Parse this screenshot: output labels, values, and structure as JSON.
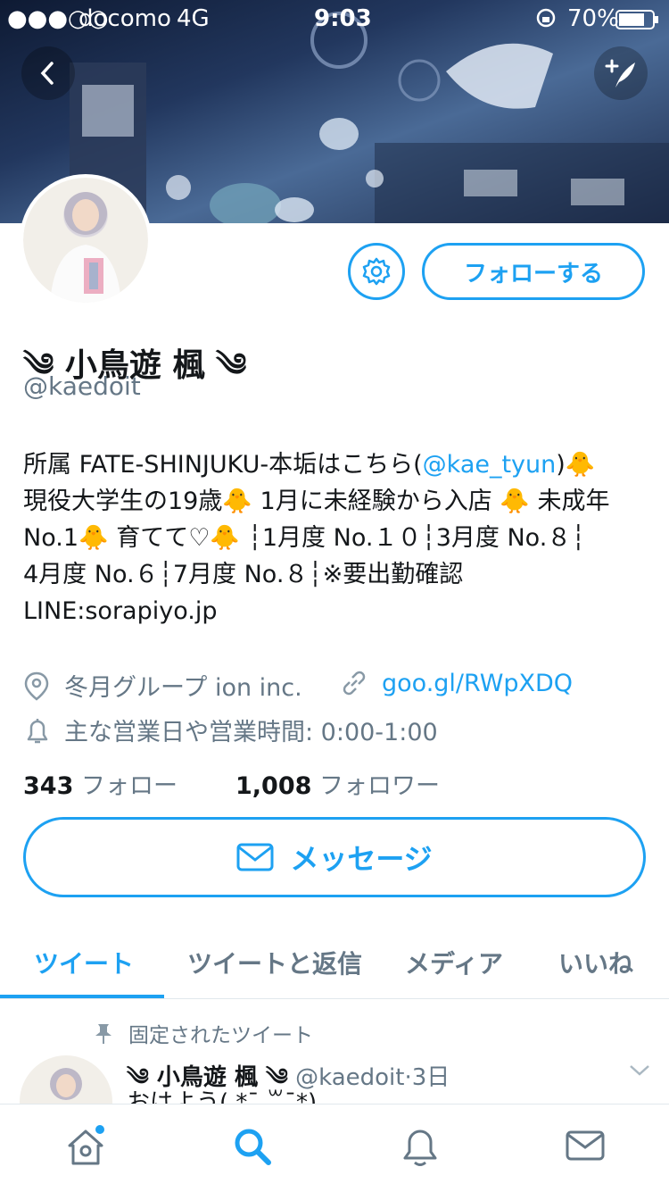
{
  "status_bar": {
    "carrier": "docomo",
    "network": "4G",
    "time": "9:03",
    "battery": "70%",
    "signal_dots": "●●●○○"
  },
  "header": {
    "back_icon": "chevron-left-icon",
    "compose_icon": "compose-feather-icon"
  },
  "profile": {
    "name": "༄ 小鳥遊 楓 ༄",
    "handle": "@kaedoit",
    "follow_label": "フォローする",
    "settings_icon": "gear-icon",
    "bio_line1_prefix": "所属 FATE-SHINJUKU-本垢はこちら(",
    "bio_line1_link": "@kae_tyun",
    "bio_line1_suffix": ")🐥",
    "bio_line2": "現役大学生の19歳🐥 1月に未経験から入店 🐥 未成年",
    "bio_line3": "No.1🐥 育てて♡🐥 ┆1月度 No.１０┆3月度 No.８┆",
    "bio_line4": "4月度 No.６┆7月度 No.８┆※要出勤確認",
    "bio_line5": "LINE:sorapiyo.jp",
    "location": "冬月グループ ion inc.",
    "url": "goo.gl/RWpXDQ",
    "hours": "主な営業日や営業時間: 0:00-1:00",
    "following_count": "343",
    "following_label": "フォロー",
    "followers_count": "1,008",
    "followers_label": "フォロワー",
    "message_label": "メッセージ"
  },
  "tabs": [
    {
      "label": "ツイート",
      "active": true
    },
    {
      "label": "ツイートと返信",
      "active": false
    },
    {
      "label": "メディア",
      "active": false
    },
    {
      "label": "いいね",
      "active": false
    }
  ],
  "pinned_tweet": {
    "pinned_label": "固定されたツイート",
    "author_name": "༄ 小鳥遊 楓 ༄",
    "author_handle": "@kaedoit",
    "time_sep": "·",
    "time": "3日",
    "text": "おはよう( *¯ ꒳¯*)"
  },
  "bottom_nav": [
    "home-icon",
    "search-icon",
    "notifications-icon",
    "messages-icon"
  ],
  "colors": {
    "accent": "#1da1f2",
    "muted": "#657786",
    "text": "#14171a"
  }
}
